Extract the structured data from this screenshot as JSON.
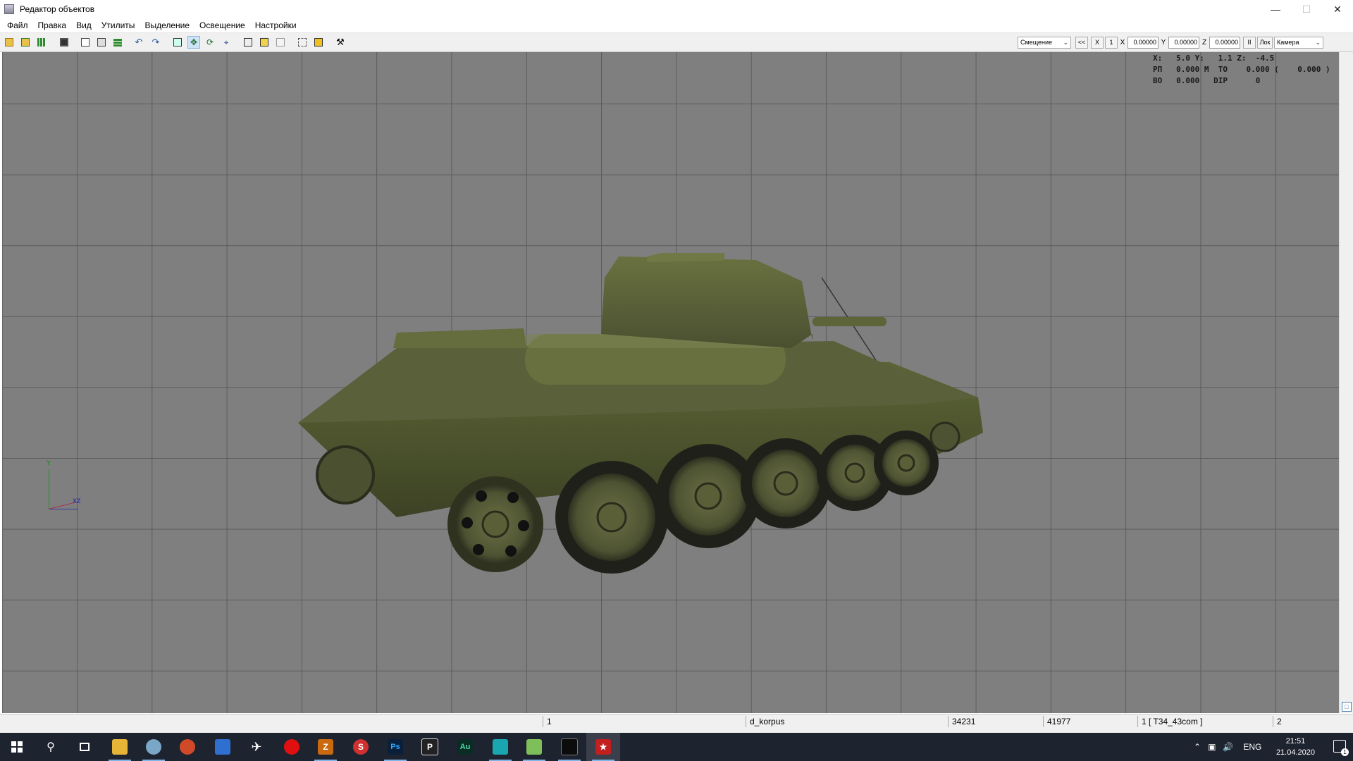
{
  "window": {
    "title": "Редактор объектов"
  },
  "menu": [
    "Файл",
    "Правка",
    "Вид",
    "Утилиты",
    "Выделение",
    "Освещение",
    "Настройки"
  ],
  "toolbar_right": {
    "mode_value": "Смещение",
    "back_label": "<<",
    "x_btn": "X",
    "one_btn": "1",
    "x_label": "X",
    "x_value": "0.00000",
    "y_label": "Y",
    "y_value": "0.00000",
    "z_label": "Z",
    "z_value": "0.00000",
    "pause_label": "II",
    "lok_label": "Лок",
    "camera_value": "Камера"
  },
  "hud": {
    "line1": "X:   5.0 Y:   1.1 Z:  -4.5",
    "line2": "РП   0.000 M  TO    0.000 (    0.000 )",
    "line3": "BO   0.000   DIP      0"
  },
  "axis": {
    "y": "Y",
    "xz": "XZ"
  },
  "status": {
    "c1": "1",
    "c2": "d_korpus",
    "c3": "34231",
    "c4": "41977",
    "c5": "1 [ T34_43com ]",
    "c6": "2"
  },
  "taskbar": {
    "apps": [
      "start-icon",
      "search-icon",
      "task-view-icon",
      "file-explorer-icon",
      "chrome-icon",
      "app-red-icon",
      "app-blue-icon",
      "app-plane-icon",
      "app-red-dot-icon",
      "filezilla-icon",
      "app-s-icon",
      "photoshop-icon",
      "app-p-icon",
      "audition-icon",
      "app-teal-icon",
      "notepad-icon",
      "terminal-icon",
      "object-editor-icon"
    ],
    "lang": "ENG",
    "time": "21:51",
    "date": "21.04.2020",
    "notif_count": "1"
  }
}
